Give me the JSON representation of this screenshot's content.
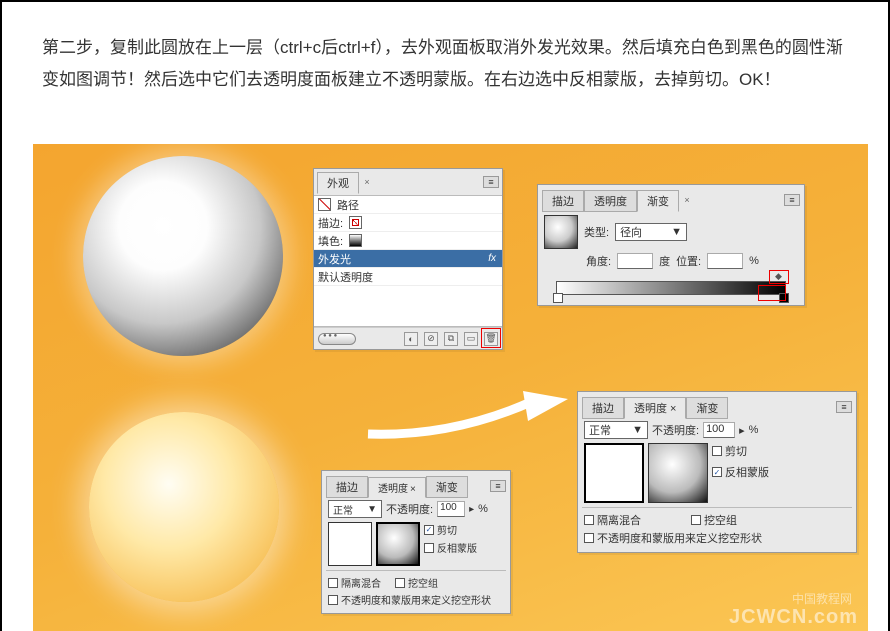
{
  "instruction_text": "第二步，复制此圆放在上一层（ctrl+c后ctrl+f），去外观面板取消外发光效果。然后填充白色到黑色的圆性渐变如图调节！然后选中它们去透明度面板建立不透明蒙版。在右边选中反相蒙版，去掉剪切。OK！",
  "appearance_panel": {
    "tab": "外观",
    "rows": {
      "path": "路径",
      "stroke": "描边:",
      "fill": "填色:",
      "outer_glow": "外发光",
      "default_trans": "默认透明度"
    },
    "fx": "fx"
  },
  "gradient_panel": {
    "tabs": {
      "stroke": "描边",
      "trans": "透明度",
      "grad": "渐变"
    },
    "type_label": "类型:",
    "type_value": "径向",
    "angle_label": "角度:",
    "angle_unit": "度",
    "pos_label": "位置:",
    "pct": "%"
  },
  "trans_small": {
    "tabs": {
      "stroke": "描边",
      "trans": "透明度",
      "grad": "渐变"
    },
    "mode": "正常",
    "opacity_label": "不透明度:",
    "opacity_value": "100",
    "pct": "%",
    "clip": "剪切",
    "invert": "反相蒙版",
    "isolate": "隔离混合",
    "knockout": "挖空组",
    "define": "不透明度和蒙版用来定义挖空形状"
  },
  "trans_large": {
    "tabs": {
      "stroke": "描边",
      "trans": "透明度",
      "grad": "渐变"
    },
    "mode": "正常",
    "opacity_label": "不透明度:",
    "opacity_value": "100",
    "pct": "%",
    "clip": "剪切",
    "invert": "反相蒙版",
    "isolate": "隔离混合",
    "knockout": "挖空组",
    "define": "不透明度和蒙版用来定义挖空形状"
  },
  "watermark": {
    "main": "JCWCN.com",
    "sub": "中国教程网"
  },
  "dropdown_arrow": "▼",
  "pct_sym": "%",
  "chevron": "▸"
}
